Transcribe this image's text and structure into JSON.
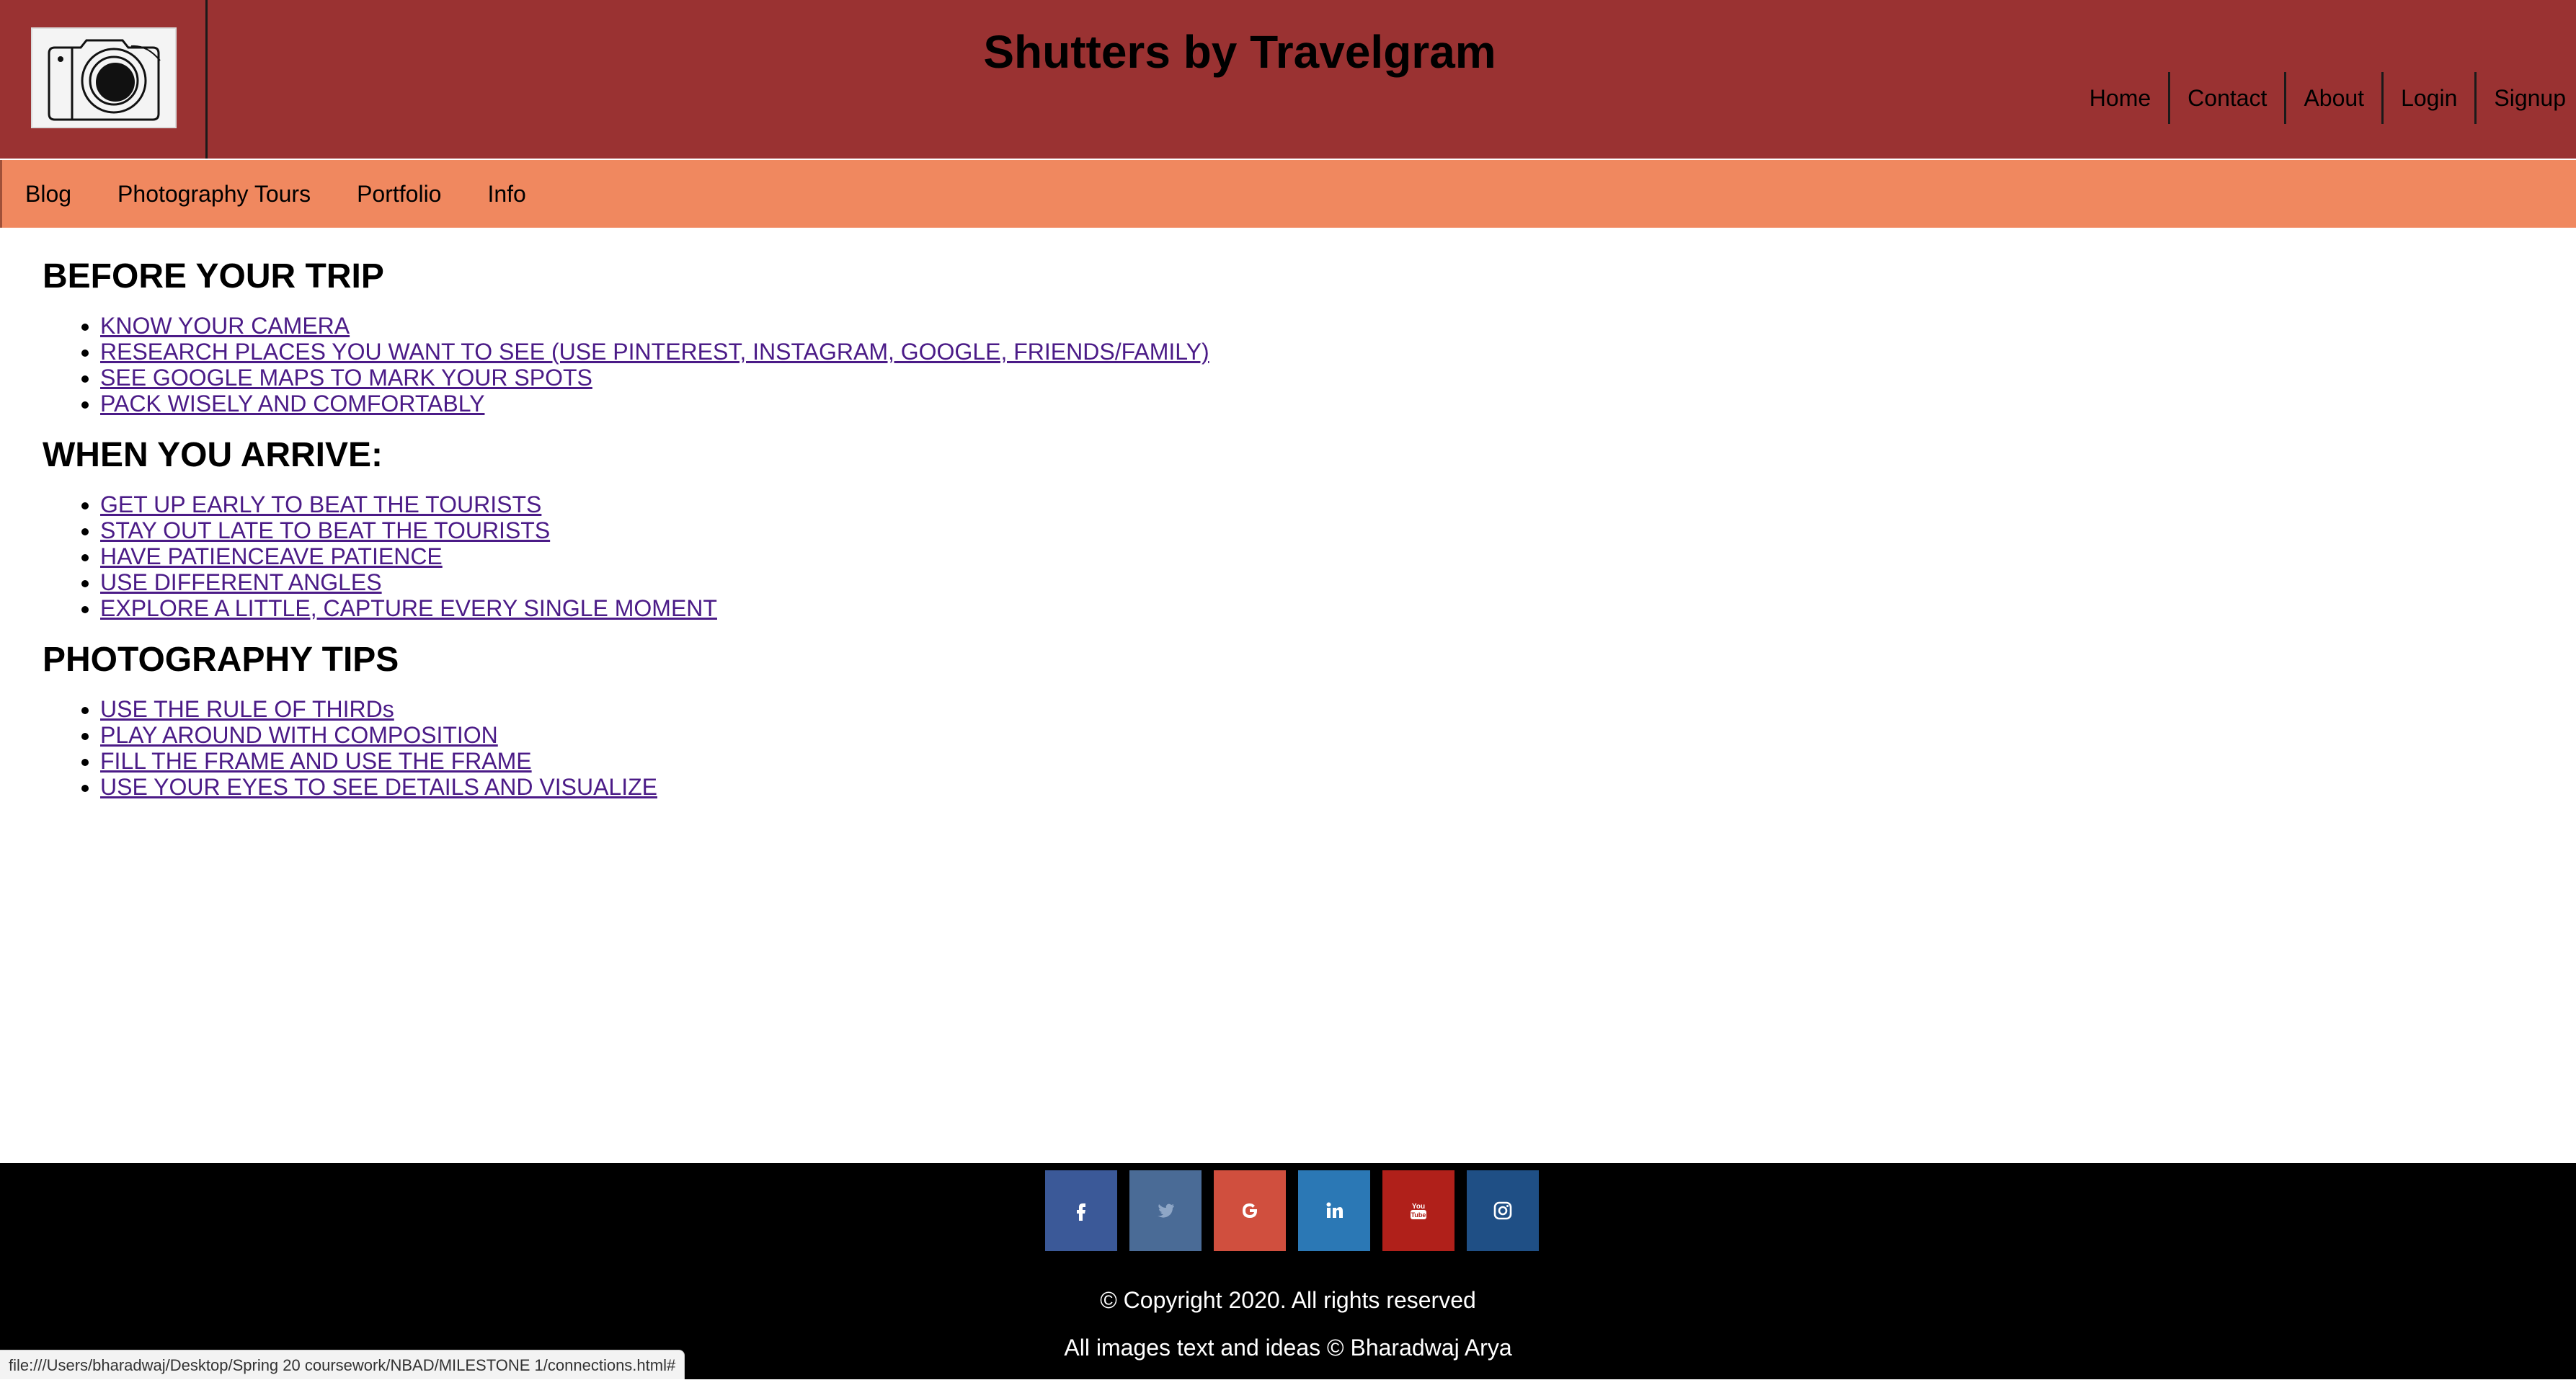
{
  "header": {
    "title": "Shutters by Travelgram",
    "logo_icon": "camera-icon",
    "nav": [
      "Home",
      "Contact",
      "About",
      "Login",
      "Signup"
    ]
  },
  "subnav": [
    "Blog",
    "Photography Tours",
    "Portfolio",
    "Info"
  ],
  "sections": [
    {
      "heading": "BEFORE YOUR TRIP",
      "items": [
        "KNOW YOUR CAMERA",
        "RESEARCH PLACES YOU WANT TO SEE (USE PINTEREST, INSTAGRAM, GOOGLE, FRIENDS/FAMILY)",
        "SEE GOOGLE MAPS TO MARK YOUR SPOTS",
        "PACK WISELY AND COMFORTABLY"
      ]
    },
    {
      "heading": "WHEN YOU ARRIVE:",
      "items": [
        "GET UP EARLY TO BEAT THE TOURISTS",
        "STAY OUT LATE TO BEAT THE TOURISTS",
        "HAVE PATIENCEAVE PATIENCE",
        "USE DIFFERENT ANGLES",
        "EXPLORE A LITTLE, CAPTURE EVERY SINGLE MOMENT"
      ]
    },
    {
      "heading": "PHOTOGRAPHY TIPS",
      "items": [
        "USE THE RULE OF THIRDs",
        "PLAY AROUND WITH COMPOSITION",
        "FILL THE FRAME AND USE THE FRAME",
        "USE YOUR EYES TO SEE DETAILS AND VISUALIZE"
      ]
    }
  ],
  "footer": {
    "social": [
      {
        "icon": "facebook-icon",
        "color": "#3b5998"
      },
      {
        "icon": "twitter-icon",
        "color": "#4a6b96"
      },
      {
        "icon": "google-icon",
        "color": "#d04f3e"
      },
      {
        "icon": "linkedin-icon",
        "color": "#2b78b5"
      },
      {
        "icon": "youtube-icon",
        "color": "#b0201a"
      },
      {
        "icon": "instagram-icon",
        "color": "#1f4f85"
      }
    ],
    "copyright": "© Copyright 2020. All rights reserved",
    "credit": "All images text and ideas © Bharadwaj Arya"
  },
  "status_bar": {
    "url": "file:///Users/bharadwaj/Desktop/Spring 20 coursework/NBAD/MILESTONE 1/connections.html#"
  },
  "colors": {
    "header_bg": "#9a3232",
    "subnav_bg": "#f0885f",
    "link": "#4b1b87",
    "footer_bg": "#000000"
  }
}
